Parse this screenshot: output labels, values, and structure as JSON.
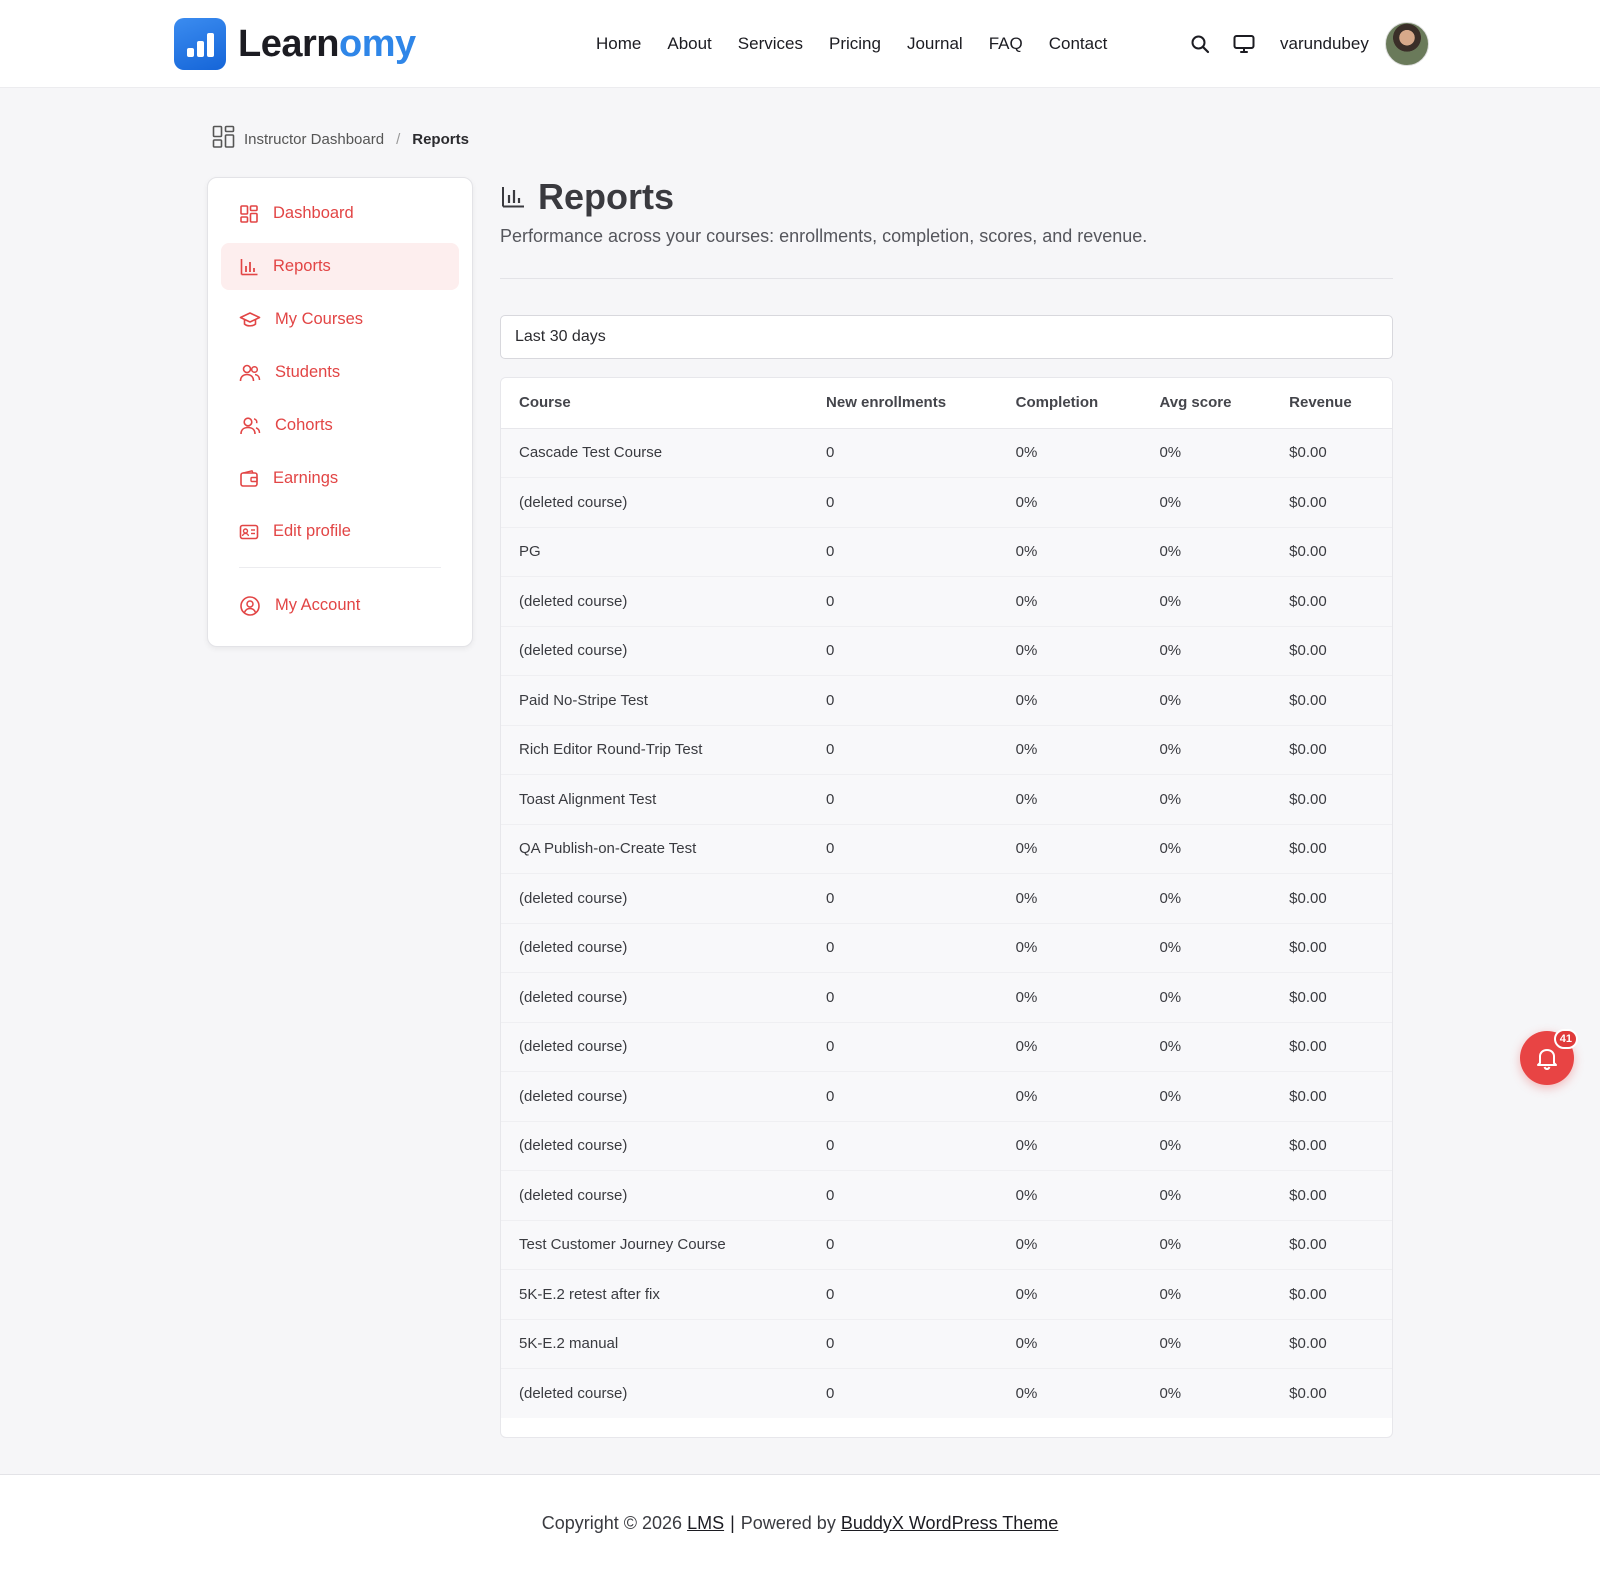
{
  "brand": {
    "name_dark": "Learn",
    "name_accent": "omy",
    "accent_color": "#2f86e8"
  },
  "nav": {
    "items": [
      "Home",
      "About",
      "Services",
      "Pricing",
      "Journal",
      "FAQ",
      "Contact"
    ]
  },
  "header_tools": {
    "search_icon": "search-icon",
    "display_icon": "monitor-icon",
    "username": "varundubey"
  },
  "breadcrumb": {
    "root": "Instructor Dashboard",
    "separator": "/",
    "current": "Reports"
  },
  "sidebar": {
    "accent_color": "#e24545",
    "items": [
      {
        "label": "Dashboard",
        "icon": "dashboard-icon",
        "active": false
      },
      {
        "label": "Reports",
        "icon": "bar-chart-icon",
        "active": true
      },
      {
        "label": "My Courses",
        "icon": "graduation-cap-icon",
        "active": false
      },
      {
        "label": "Students",
        "icon": "users-icon",
        "active": false
      },
      {
        "label": "Cohorts",
        "icon": "cohort-icon",
        "active": false
      },
      {
        "label": "Earnings",
        "icon": "wallet-icon",
        "active": false
      },
      {
        "label": "Edit profile",
        "icon": "id-card-icon",
        "active": false
      }
    ],
    "account": {
      "label": "My Account",
      "icon": "user-circle-icon"
    }
  },
  "main": {
    "title": "Reports",
    "subtitle": "Performance across your courses: enrollments, completion, scores, and revenue.",
    "range": "Last 30 days",
    "table": {
      "headers": [
        "Course",
        "New enrollments",
        "Completion",
        "Avg score",
        "Revenue"
      ],
      "rows": [
        [
          "Cascade Test Course",
          "0",
          "0%",
          "0%",
          "$0.00"
        ],
        [
          "(deleted course)",
          "0",
          "0%",
          "0%",
          "$0.00"
        ],
        [
          "PG",
          "0",
          "0%",
          "0%",
          "$0.00"
        ],
        [
          "(deleted course)",
          "0",
          "0%",
          "0%",
          "$0.00"
        ],
        [
          "(deleted course)",
          "0",
          "0%",
          "0%",
          "$0.00"
        ],
        [
          "Paid No-Stripe Test",
          "0",
          "0%",
          "0%",
          "$0.00"
        ],
        [
          "Rich Editor Round-Trip Test",
          "0",
          "0%",
          "0%",
          "$0.00"
        ],
        [
          "Toast Alignment Test",
          "0",
          "0%",
          "0%",
          "$0.00"
        ],
        [
          "QA Publish-on-Create Test",
          "0",
          "0%",
          "0%",
          "$0.00"
        ],
        [
          "(deleted course)",
          "0",
          "0%",
          "0%",
          "$0.00"
        ],
        [
          "(deleted course)",
          "0",
          "0%",
          "0%",
          "$0.00"
        ],
        [
          "(deleted course)",
          "0",
          "0%",
          "0%",
          "$0.00"
        ],
        [
          "(deleted course)",
          "0",
          "0%",
          "0%",
          "$0.00"
        ],
        [
          "(deleted course)",
          "0",
          "0%",
          "0%",
          "$0.00"
        ],
        [
          "(deleted course)",
          "0",
          "0%",
          "0%",
          "$0.00"
        ],
        [
          "(deleted course)",
          "0",
          "0%",
          "0%",
          "$0.00"
        ],
        [
          "Test Customer Journey Course",
          "0",
          "0%",
          "0%",
          "$0.00"
        ],
        [
          "5K-E.2 retest after fix",
          "0",
          "0%",
          "0%",
          "$0.00"
        ],
        [
          "5K-E.2 manual",
          "0",
          "0%",
          "0%",
          "$0.00"
        ],
        [
          "(deleted course)",
          "0",
          "0%",
          "0%",
          "$0.00"
        ]
      ]
    }
  },
  "footer": {
    "prefix": "Copyright © 2026",
    "site_link": "LMS",
    "separator": "|",
    "powered_prefix": "Powered by",
    "theme_link": "BuddyX WordPress Theme"
  },
  "notifications": {
    "count": "41",
    "color": "#e84444"
  }
}
